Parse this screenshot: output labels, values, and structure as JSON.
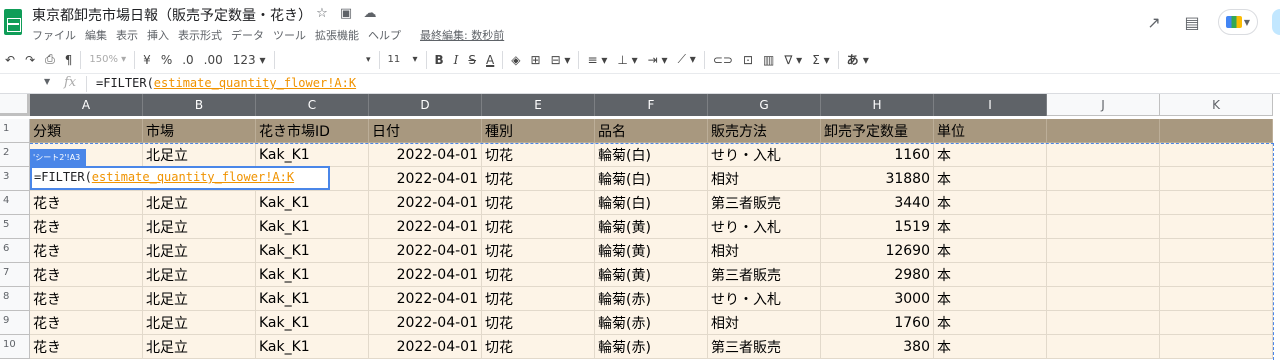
{
  "title": {
    "doc_title": "東京都卸売市場日報（販売予定数量・花き）",
    "menu": [
      "ファイル",
      "編集",
      "表示",
      "挿入",
      "表示形式",
      "データ",
      "ツール",
      "拡張機能",
      "ヘルプ"
    ],
    "last_edit": "最終編集: 数秒前"
  },
  "toolbar": {
    "zoom": "150%",
    "currency": "¥",
    "percent": "%",
    "dec_decrease": ".0",
    "dec_increase": ".00",
    "number_format": "123",
    "font_size": "11",
    "bold": "B",
    "italic": "I",
    "strike": "S",
    "text_color": "A",
    "sum": "Σ",
    "input_tools": "あ"
  },
  "formula_bar": {
    "fx": "fx",
    "prefix": "=FILTER(",
    "range": "estimate_quantity_flower!A:K"
  },
  "columns": [
    "A",
    "B",
    "C",
    "D",
    "E",
    "F",
    "G",
    "H",
    "I",
    "J",
    "K"
  ],
  "row_numbers": [
    "1",
    "2",
    "3",
    "4",
    "5",
    "6",
    "7",
    "8",
    "9",
    "10"
  ],
  "ref_chip": "'シート2'!A3",
  "edit_box": {
    "prefix": "=FILTER(",
    "range": "estimate_quantity_flower!A:K"
  },
  "rows": [
    [
      "分類",
      "市場",
      "花き市場ID",
      "日付",
      "種別",
      "品名",
      "販売方法",
      "卸売予定数量",
      "単位",
      "",
      ""
    ],
    [
      "",
      "北足立",
      "Kak_K1",
      "2022-04-01",
      "切花",
      "輪菊(白)",
      "せり・入札",
      "1160",
      "本",
      "",
      ""
    ],
    [
      "",
      "",
      "",
      "2022-04-01",
      "切花",
      "輪菊(白)",
      "相対",
      "31880",
      "本",
      "",
      ""
    ],
    [
      "花き",
      "北足立",
      "Kak_K1",
      "2022-04-01",
      "切花",
      "輪菊(白)",
      "第三者販売",
      "3440",
      "本",
      "",
      ""
    ],
    [
      "花き",
      "北足立",
      "Kak_K1",
      "2022-04-01",
      "切花",
      "輪菊(黄)",
      "せり・入札",
      "1519",
      "本",
      "",
      ""
    ],
    [
      "花き",
      "北足立",
      "Kak_K1",
      "2022-04-01",
      "切花",
      "輪菊(黄)",
      "相対",
      "12690",
      "本",
      "",
      ""
    ],
    [
      "花き",
      "北足立",
      "Kak_K1",
      "2022-04-01",
      "切花",
      "輪菊(黄)",
      "第三者販売",
      "2980",
      "本",
      "",
      ""
    ],
    [
      "花き",
      "北足立",
      "Kak_K1",
      "2022-04-01",
      "切花",
      "輪菊(赤)",
      "せり・入札",
      "3000",
      "本",
      "",
      ""
    ],
    [
      "花き",
      "北足立",
      "Kak_K1",
      "2022-04-01",
      "切花",
      "輪菊(赤)",
      "相対",
      "1760",
      "本",
      "",
      ""
    ],
    [
      "花き",
      "北足立",
      "Kak_K1",
      "2022-04-01",
      "切花",
      "輪菊(赤)",
      "第三者販売",
      "380",
      "本",
      "",
      ""
    ]
  ],
  "colors": {
    "header_fill": "#a8987f",
    "body_fill": "#fdf4e7",
    "column_header_fill": "#5f6368",
    "selection": "#4a86e8",
    "formula_range": "#f09300"
  }
}
